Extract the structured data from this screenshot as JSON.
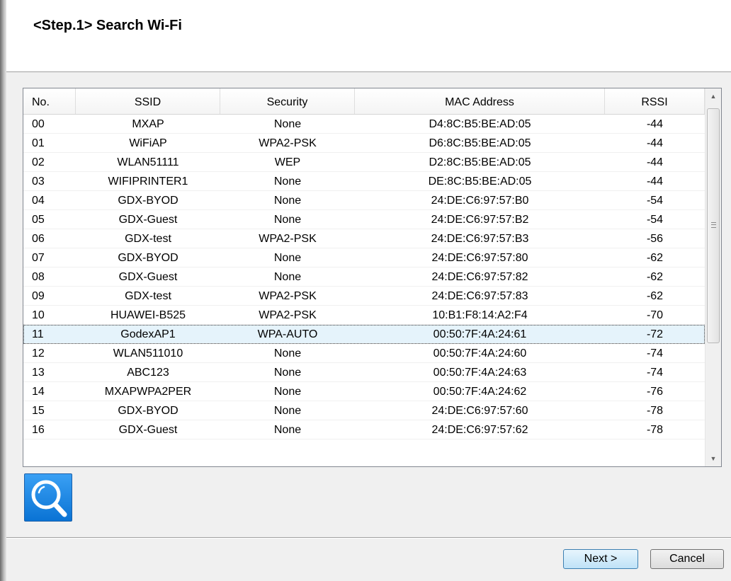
{
  "header": {
    "title": "<Step.1>  Search Wi-Fi"
  },
  "table": {
    "columns": [
      "No.",
      "SSID",
      "Security",
      "MAC Address",
      "RSSI"
    ],
    "rows": [
      {
        "no": "00",
        "ssid": "MXAP",
        "security": "None",
        "mac": "D4:8C:B5:BE:AD:05",
        "rssi": "-44"
      },
      {
        "no": "01",
        "ssid": "WiFiAP",
        "security": "WPA2-PSK",
        "mac": "D6:8C:B5:BE:AD:05",
        "rssi": "-44"
      },
      {
        "no": "02",
        "ssid": "WLAN51111",
        "security": "WEP",
        "mac": "D2:8C:B5:BE:AD:05",
        "rssi": "-44"
      },
      {
        "no": "03",
        "ssid": "WIFIPRINTER1",
        "security": "None",
        "mac": "DE:8C:B5:BE:AD:05",
        "rssi": "-44"
      },
      {
        "no": "04",
        "ssid": "GDX-BYOD",
        "security": "None",
        "mac": "24:DE:C6:97:57:B0",
        "rssi": "-54"
      },
      {
        "no": "05",
        "ssid": "GDX-Guest",
        "security": "None",
        "mac": "24:DE:C6:97:57:B2",
        "rssi": "-54"
      },
      {
        "no": "06",
        "ssid": "GDX-test",
        "security": "WPA2-PSK",
        "mac": "24:DE:C6:97:57:B3",
        "rssi": "-56"
      },
      {
        "no": "07",
        "ssid": "GDX-BYOD",
        "security": "None",
        "mac": "24:DE:C6:97:57:80",
        "rssi": "-62"
      },
      {
        "no": "08",
        "ssid": "GDX-Guest",
        "security": "None",
        "mac": "24:DE:C6:97:57:82",
        "rssi": "-62"
      },
      {
        "no": "09",
        "ssid": "GDX-test",
        "security": "WPA2-PSK",
        "mac": "24:DE:C6:97:57:83",
        "rssi": "-62"
      },
      {
        "no": "10",
        "ssid": "HUAWEI-B525",
        "security": "WPA2-PSK",
        "mac": "10:B1:F8:14:A2:F4",
        "rssi": "-70"
      },
      {
        "no": "11",
        "ssid": "GodexAP1",
        "security": "WPA-AUTO",
        "mac": "00:50:7F:4A:24:61",
        "rssi": "-72"
      },
      {
        "no": "12",
        "ssid": "WLAN511010",
        "security": "None",
        "mac": "00:50:7F:4A:24:60",
        "rssi": "-74"
      },
      {
        "no": "13",
        "ssid": "ABC123",
        "security": "None",
        "mac": "00:50:7F:4A:24:63",
        "rssi": "-74"
      },
      {
        "no": "14",
        "ssid": "MXAPWPA2PER",
        "security": "None",
        "mac": "00:50:7F:4A:24:62",
        "rssi": "-76"
      },
      {
        "no": "15",
        "ssid": "GDX-BYOD",
        "security": "None",
        "mac": "24:DE:C6:97:57:60",
        "rssi": "-78"
      },
      {
        "no": "16",
        "ssid": "GDX-Guest",
        "security": "None",
        "mac": "24:DE:C6:97:57:62",
        "rssi": "-78"
      }
    ],
    "selected_index": 11
  },
  "search_button": {
    "icon": "magnifier-icon"
  },
  "footer": {
    "next_label": "Next >",
    "cancel_label": "Cancel"
  },
  "colors": {
    "selection": "#e5f3fb",
    "search_button": "#0a73d4",
    "next_border": "#3c7fb1"
  }
}
